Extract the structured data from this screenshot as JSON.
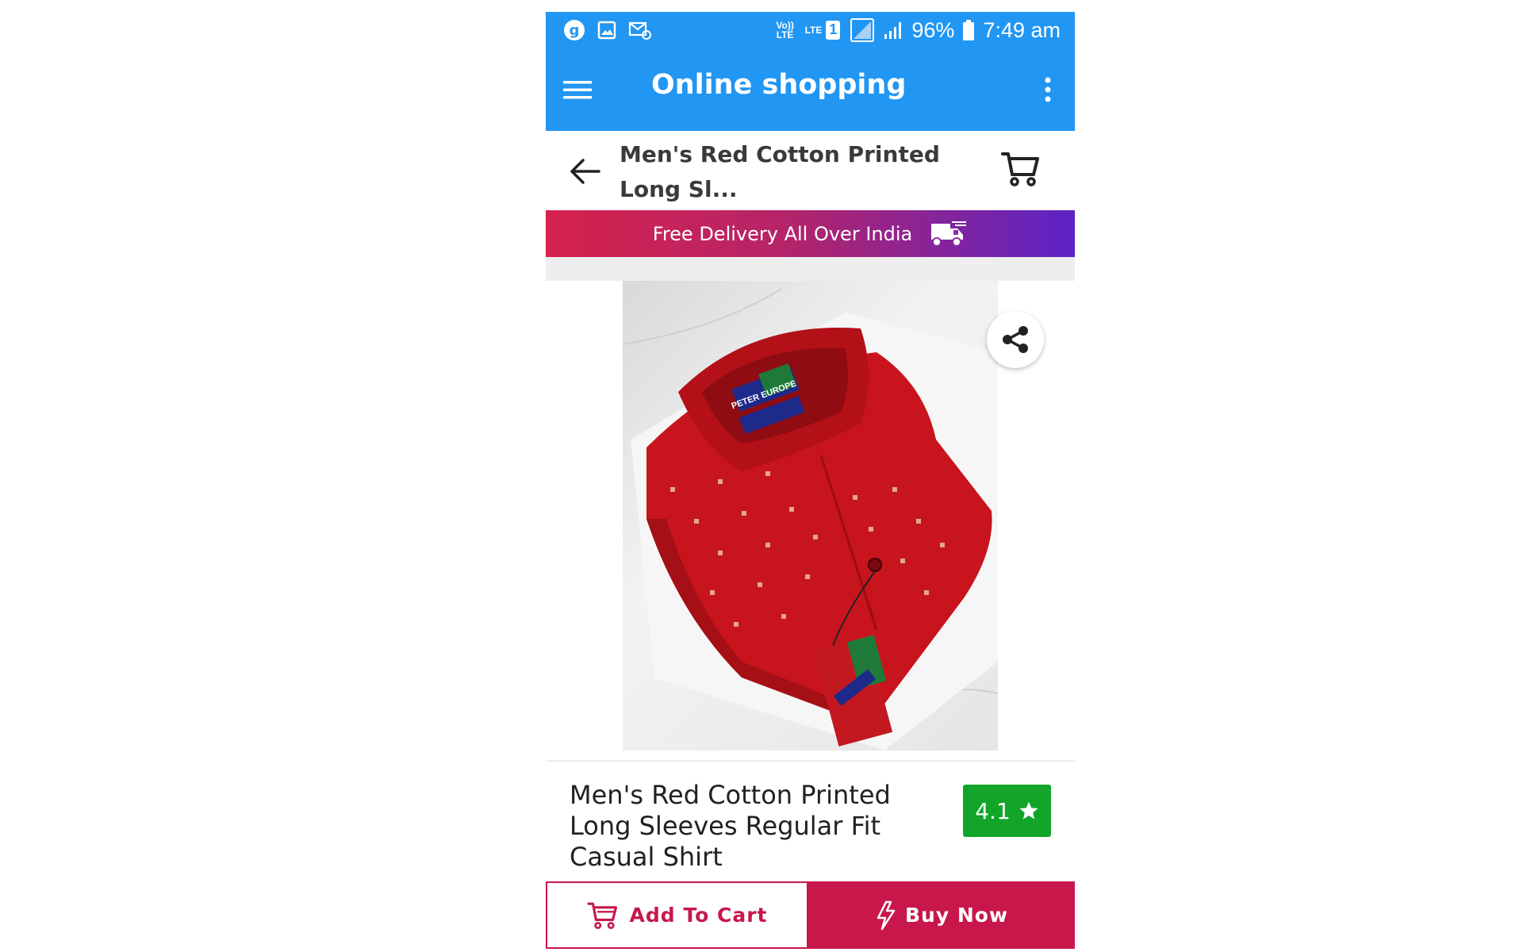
{
  "status_bar": {
    "volte_label": "Vo)) LTE",
    "lte_label": "LTE",
    "sim_number": "1",
    "battery": "96%",
    "time": "7:49 am"
  },
  "app_bar": {
    "title": "Online shopping"
  },
  "sub_header": {
    "product_heading": "Men's Red Cotton Printed Long Sl..."
  },
  "delivery_banner": {
    "text": "Free Delivery All Over India"
  },
  "product": {
    "image_tag_text": "PETER EUROPE",
    "name": "Men's Red Cotton Printed Long Sleeves Regular Fit Casual Shirt",
    "rating": "4.1"
  },
  "actions": {
    "add_to_cart": "Add To Cart",
    "buy_now": "Buy Now"
  },
  "colors": {
    "primary": "#2196F3",
    "accent": "#c8174b",
    "rating_green": "#12a52a"
  },
  "icons": [
    "g-app-icon",
    "gallery-icon",
    "email-icon",
    "sim-icon",
    "signal-icon",
    "battery-icon",
    "menu-icon",
    "more-vert-icon",
    "arrow-back-icon",
    "cart-icon",
    "delivery-truck-icon",
    "share-icon",
    "star-icon",
    "flash-icon"
  ]
}
